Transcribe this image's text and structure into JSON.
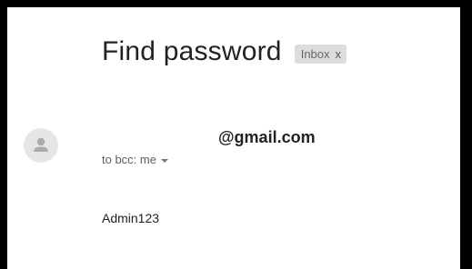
{
  "email": {
    "subject": "Find password",
    "label": {
      "text": "Inbox",
      "close_glyph": "x"
    },
    "sender": "@gmail.com",
    "recipients": "to bcc: me",
    "body": "Admin123"
  },
  "icons": {
    "avatar": "person-avatar-icon",
    "recipients_toggle": "caret-down-icon",
    "label_remove": "close-icon"
  },
  "colors": {
    "border": "#000000",
    "background": "#ffffff",
    "avatar_bg": "#e6e6e6",
    "label_chip_bg": "#dddddd",
    "text_primary": "#222222",
    "text_secondary": "#5f5f5f"
  }
}
